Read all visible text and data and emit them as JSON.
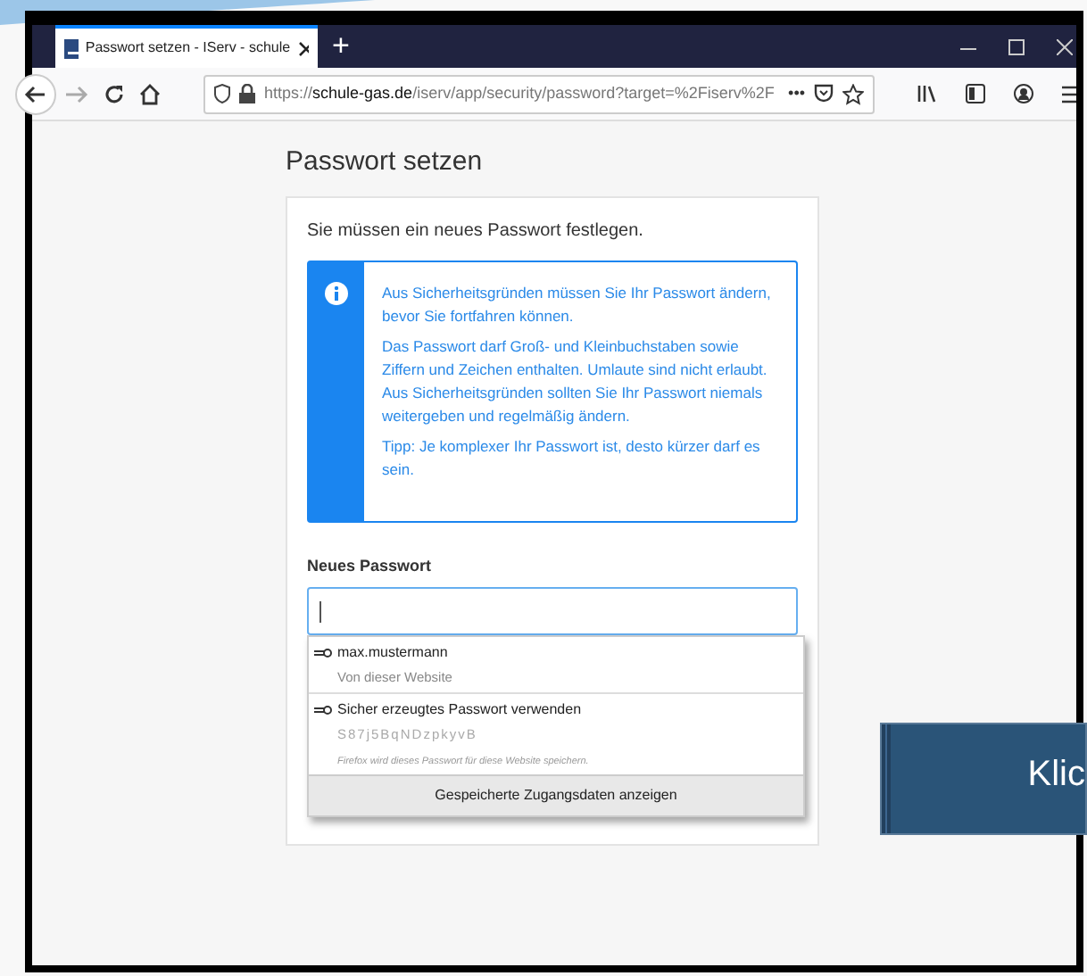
{
  "browser": {
    "tab": {
      "title": "Passwort setzen - IServ - schule",
      "selected": true
    },
    "new_tab": "+",
    "url": {
      "prefix": "https://",
      "domain": "schule-gas.de",
      "path": "/iserv/app/security/password?target=%2Fiserv%2F"
    },
    "url_more": "•••"
  },
  "page": {
    "title": "Passwort setzen",
    "intro": "Sie müssen ein neues Passwort festlegen.",
    "info": [
      "Aus Sicherheitsgründen müssen Sie Ihr Passwort ändern, bevor Sie fortfahren können.",
      "Das Passwort darf Groß- und Kleinbuchstaben sowie Ziffern und Zeichen enthalten. Umlaute sind nicht erlaubt. Aus Sicherheitsgründen sollten Sie Ihr Passwort niemals weitergeben und regelmäßig ändern.",
      "Tipp: Je komplexer Ihr Passwort ist, desto kürzer darf es sein."
    ],
    "field_label": "Neues Passwort",
    "autocomplete": [
      {
        "title": "max.mustermann",
        "subtitle": "Von dieser Website"
      },
      {
        "title": "Sicher erzeugtes Passwort verwenden",
        "subtitle": "S87j5BqNDzpkyvB",
        "note": "Firefox wird dieses Passwort für diese Website speichern."
      }
    ],
    "autocomplete_footer": "Gespeicherte Zugangsdaten anzeigen"
  },
  "callout": {
    "text": "Klic"
  }
}
